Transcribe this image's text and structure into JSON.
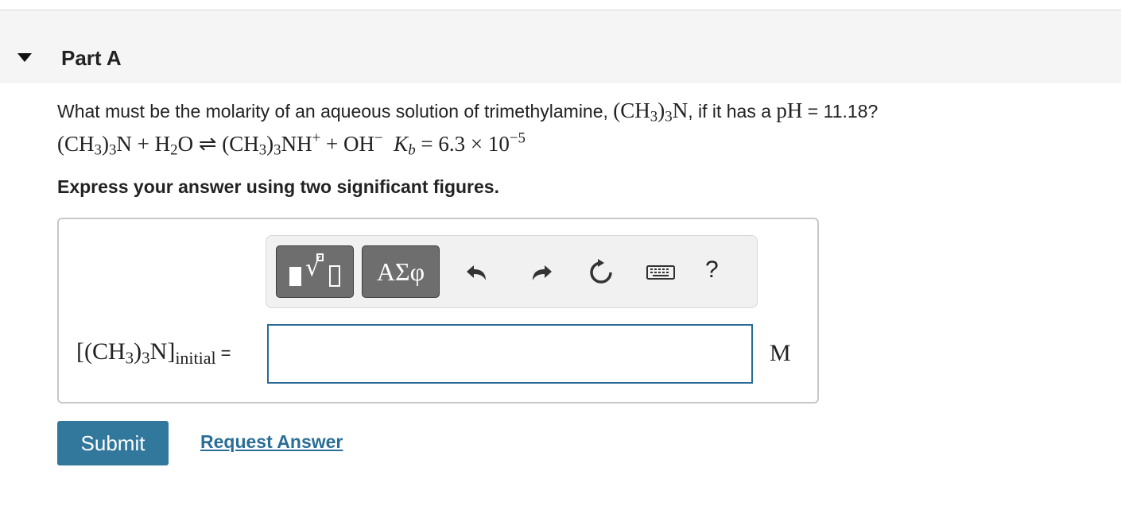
{
  "part": {
    "title": "Part A"
  },
  "question": {
    "text_prefix": "What must be the molarity of an aqueous solution of trimethylamine, ",
    "text_mid": ", if it has a ",
    "ph_symbol": "pH",
    "ph_value": " = 11.18?",
    "formula_open": "(CH",
    "formula_sub": "3",
    "formula_close": ")",
    "formula_sub2": "3",
    "formula_end": "N"
  },
  "equation": {
    "reactant_open": "(CH",
    "sub3a": "3",
    "reactant_close": ")",
    "sub3b": "3",
    "reactant_n": "N + H",
    "sub2": "2",
    "water_o": "O ",
    "arrow": "⇌",
    "product_open": " (CH",
    "sub3c": "3",
    "product_close": ")",
    "sub3d": "3",
    "product_nh": "NH",
    "plus_sup": "+",
    "oh_part": " + OH",
    "minus_sup": "−",
    "kb_symbol": "K",
    "kb_sub": "b",
    "kb_value": " = 6.3 × 10",
    "kb_exp": "−5"
  },
  "instruction": "Express your answer using two significant figures.",
  "toolbar": {
    "symbols_label": "ΑΣφ",
    "help_label": "?"
  },
  "answer": {
    "label_open": "[(CH",
    "label_sub3a": "3",
    "label_close": ")",
    "label_sub3b": "3",
    "label_n": "N]",
    "label_subscript": "initial",
    "equals": "=",
    "value": "",
    "unit": "M"
  },
  "actions": {
    "submit_label": "Submit",
    "request_label": "Request Answer"
  },
  "colors": {
    "submit_bg": "#31789c",
    "link": "#2a6d96",
    "input_border": "#2a6a97",
    "toolbar_button": "#6e6e6e"
  }
}
